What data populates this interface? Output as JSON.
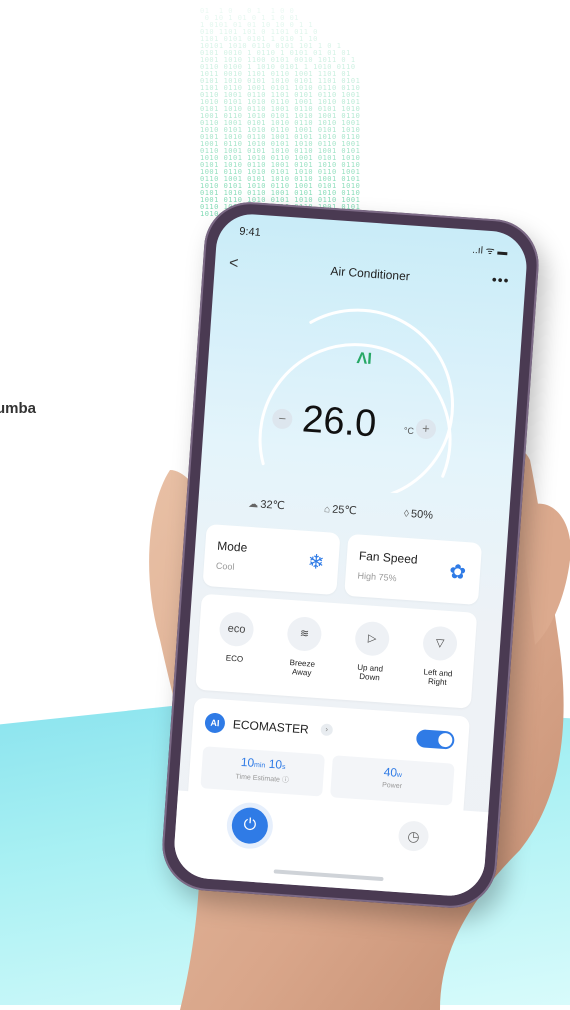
{
  "side_text": "umba",
  "binary_art": "01  1 0   0 1  1 0 0\n 0 10 1 01 0 1 1 0 01\n1 0101 01 01 10 10 0 1 1\n010 1101 101 0 1101 011 0\n1101 0101 0101 1 010 1 10\n10101 1010 0110 0101 101 1 0 1\n0101 0010 1 0110 1 0101 01 01 01\n1001 1010 1100 0101 0010 1011 0 1\n0110 0100 1 1010 0101 1 1010 0110\n1011 0010 1101 0110 1001 1101 01\n0101 1010 0101 1010 0101 1101 0101\n1101 0110 1001 0101 1010 0110 0110\n0110 1001 0110 1101 0101 0110 1001\n1010 0101 1010 0110 1001 1010 0101\n0101 1010 0110 1001 0110 0101 1010\n1001 0110 1010 0101 1010 1001 0110\n0110 1001 0101 1010 0110 1010 1001\n1010 0101 1010 0110 1001 0101 1010\n0101 1010 0110 1001 0101 1010 0110\n1001 0110 1010 0101 1010 0110 1001\n0110 1001 0101 1010 0110 1001 0101\n1010 0101 1010 0110 1001 0101 1010\n0101 1010 0110 1001 0101 1010 0110\n1001 0110 1010 0101 1010 0110 1001\n0110 1001 0101 1010 0110 1001 0101\n1010 0101 1010 0110 1001 0101 1010\n0101 1010 0110 1001 0101 1010 0110\n1001 0110 1010 0101 1010 0110 1001\n0110 1001 0101 1010 0110 1001 0101\n1010 0101 1010 0110 1001 0101 1010",
  "status": {
    "time": "9:41",
    "icons": "..ıl ᯤ ▬"
  },
  "nav": {
    "back": "<",
    "title": "Air Conditioner",
    "more": "•••"
  },
  "temp": {
    "ai_logo": "ΛI",
    "minus": "−",
    "plus": "+",
    "value": "26.0",
    "unit": "°C",
    "dial_level": 0.85
  },
  "env": [
    {
      "icon": "cloud-icon",
      "glyph": "☁",
      "value": "32℃"
    },
    {
      "icon": "house-thermometer-icon",
      "glyph": "⌂",
      "value": "25℃"
    },
    {
      "icon": "humidity-drop-icon",
      "glyph": "◊",
      "value": "50%"
    }
  ],
  "mode": {
    "title": "Mode",
    "value": "Cool"
  },
  "fan": {
    "title": "Fan Speed",
    "value": "High 75%"
  },
  "functions": [
    {
      "icon": "eco-icon",
      "glyph": "eco",
      "label": "ECO"
    },
    {
      "icon": "breeze-away-icon",
      "glyph": "≋",
      "label": "Breeze\nAway"
    },
    {
      "icon": "swing-up-down-icon",
      "glyph": "▷",
      "label": "Up and\nDown"
    },
    {
      "icon": "swing-left-right-icon",
      "glyph": "▽",
      "label": "Left and\nRight"
    }
  ],
  "ecomaster": {
    "badge": "AI",
    "name": "ECOMASTER",
    "chevron": "›",
    "enabled": true,
    "time_main": "10",
    "time_min_unit": "min",
    "time_sec": "10",
    "time_sec_unit": "s",
    "time_label": "Time Estimate ⓘ",
    "power_value": "40",
    "power_unit": "w",
    "power_label": "Power"
  },
  "colors": {
    "accent": "#2f7be6",
    "ai_green": "#27a866",
    "teal_band": "#a8f0f3"
  }
}
